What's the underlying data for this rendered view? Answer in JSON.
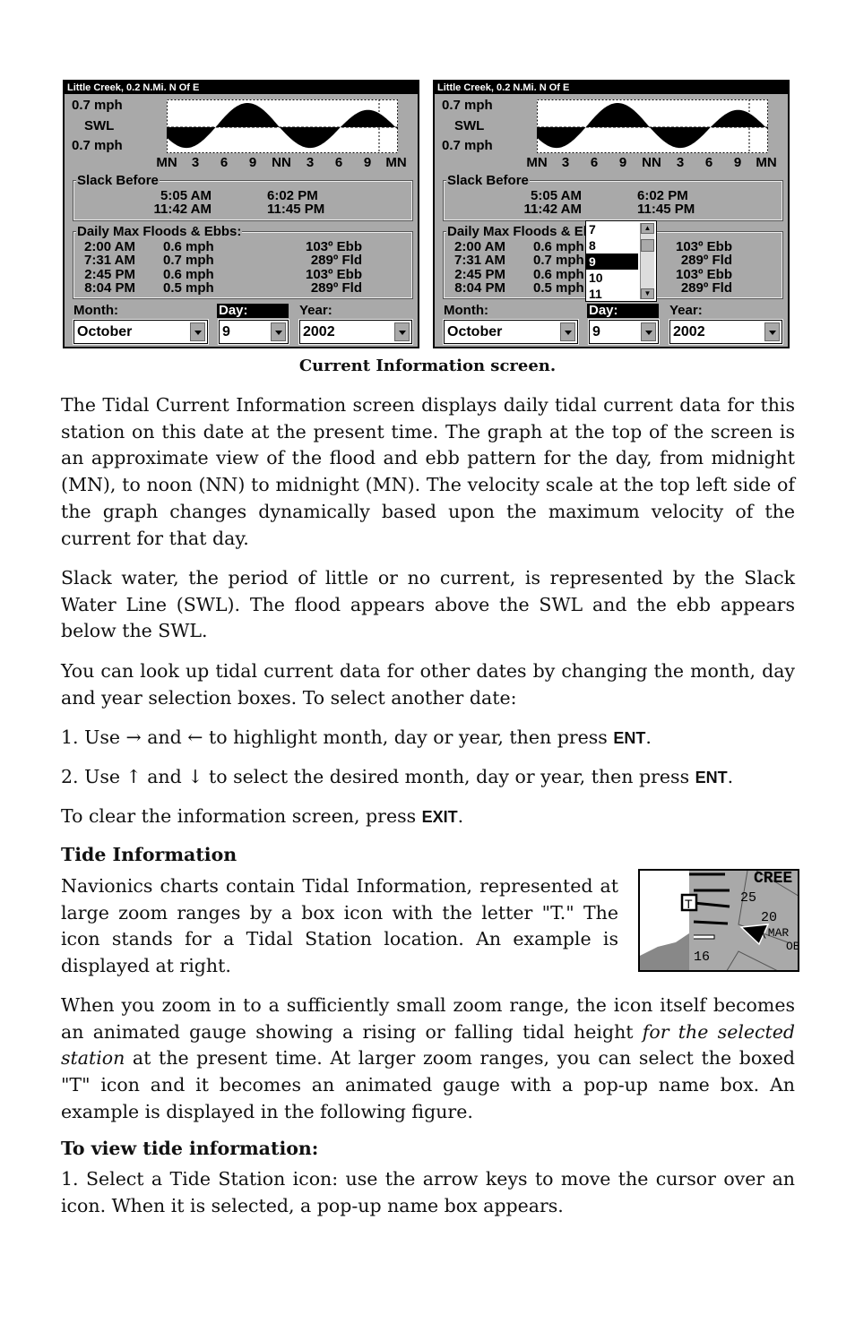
{
  "screens": [
    {
      "title": "Little Creek, 0.2 N.Mi. N Of E",
      "scale_top": "0.7 mph",
      "swl": "SWL",
      "scale_bottom": "0.7 mph",
      "ticks": [
        "MN",
        "3",
        "6",
        "9",
        "NN",
        "3",
        "6",
        "9",
        "MN"
      ],
      "slack_label": "Slack Before",
      "slack": [
        [
          "5:05 AM",
          "6:02 PM"
        ],
        [
          "11:42 AM",
          "11:45 PM"
        ]
      ],
      "daily_label": "Daily Max Floods & Ebbs:",
      "daily": [
        {
          "time": "2:00 AM",
          "speed": "0.6 mph",
          "dir": "103º Ebb"
        },
        {
          "time": "7:31 AM",
          "speed": "0.7 mph",
          "dir": "289º Fld"
        },
        {
          "time": "2:45 PM",
          "speed": "0.6 mph",
          "dir": "103º Ebb"
        },
        {
          "time": "8:04 PM",
          "speed": "0.5 mph",
          "dir": "289º Fld"
        }
      ],
      "month_label": "Month:",
      "day_label": "Day:",
      "year_label": "Year:",
      "month": "October",
      "day": "9",
      "year": "2002",
      "day_list_open": false
    },
    {
      "title": "Little Creek, 0.2 N.Mi. N Of E",
      "scale_top": "0.7 mph",
      "swl": "SWL",
      "scale_bottom": "0.7 mph",
      "ticks": [
        "MN",
        "3",
        "6",
        "9",
        "NN",
        "3",
        "6",
        "9",
        "MN"
      ],
      "slack_label": "Slack Before",
      "slack": [
        [
          "5:05 AM",
          "6:02 PM"
        ],
        [
          "11:42 AM",
          "11:45 PM"
        ]
      ],
      "daily_label": "Daily Max Floods & Ebbs:",
      "daily": [
        {
          "time": "2:00 AM",
          "speed": "0.6 mph",
          "dir": "103º Ebb"
        },
        {
          "time": "7:31 AM",
          "speed": "0.7 mph",
          "dir": "289º Fld"
        },
        {
          "time": "2:45 PM",
          "speed": "0.6 mph",
          "dir": "103º Ebb"
        },
        {
          "time": "8:04 PM",
          "speed": "0.5 mph",
          "dir": "289º Fld"
        }
      ],
      "month_label": "Month:",
      "day_label": "Day:",
      "year_label": "Year:",
      "month": "October",
      "day": "9",
      "year": "2002",
      "day_list_open": true,
      "day_options": [
        "7",
        "8",
        "9",
        "10",
        "11"
      ],
      "day_selected": "9"
    }
  ],
  "caption": "Current Information screen.",
  "para1": "The Tidal Current Information screen displays daily tidal current data for this station on this date at the present time. The graph at the top of the screen is an approximate view of the flood and ebb pattern for the day, from midnight (MN), to noon (NN) to midnight (MN). The velocity scale at the top left side of the graph changes dynamically based upon the maximum velocity of the current for that day.",
  "para2": "Slack water, the period of little or no current, is represented by the Slack Water Line (SWL). The flood appears above the SWL and the ebb appears below the SWL.",
  "para3": "You can look up tidal current data for other dates by changing the month, day and year selection boxes. To select another date:",
  "step1": {
    "pre": "1. Use → and ← to highlight month, day or year, then press ",
    "key": "ENT",
    "post": "."
  },
  "step2": {
    "pre": "2. Use ↑ and ↓ to select the desired month, day or year, then press ",
    "key": "ENT",
    "post": "."
  },
  "clear": {
    "pre": "To clear the information screen, press ",
    "key": "EXIT",
    "post": "."
  },
  "tide_heading": "Tide Information",
  "tide_para": "Navionics charts contain Tidal Information, represented at large zoom ranges by a box icon with the letter \"T.\" The icon stands for a Tidal Station location. An example is displayed at right.",
  "map": {
    "labels": [
      "CREE",
      "25",
      "20",
      "(MAR",
      "OB",
      "16"
    ],
    "icon_letter": "T"
  },
  "zoom_para": {
    "a": "When you zoom in to a sufficiently small zoom range, the icon itself becomes an animated gauge showing a rising or falling tidal height ",
    "em": "for the selected station",
    "b": " at the present time. At larger zoom ranges, you can select the boxed \"T\" icon and it becomes an animated gauge with a pop-up name box. An example is displayed in the following figure."
  },
  "view_heading": "To view tide information:",
  "view_step": "1. Select a Tide Station icon: use the arrow keys to move the cursor over an icon. When it is selected, a pop-up name box appears."
}
